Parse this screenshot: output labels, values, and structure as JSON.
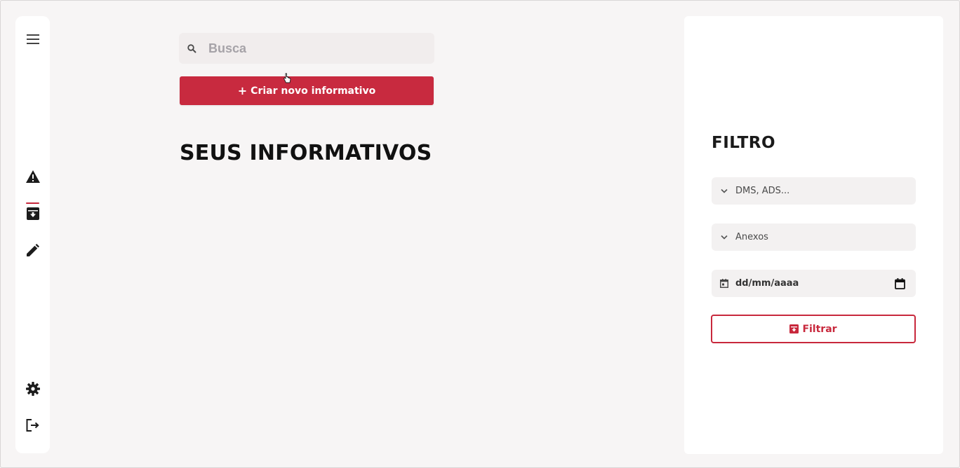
{
  "sidebar": {
    "items": [
      {
        "name": "menu",
        "icon": "menu-icon"
      },
      {
        "name": "warning",
        "icon": "warning-icon",
        "active": true
      },
      {
        "name": "archive",
        "icon": "archive-icon"
      },
      {
        "name": "edit",
        "icon": "pencil-icon"
      },
      {
        "name": "settings",
        "icon": "gear-icon"
      },
      {
        "name": "logout",
        "icon": "logout-icon"
      }
    ]
  },
  "main": {
    "search": {
      "placeholder": "Busca",
      "value": ""
    },
    "create_button": {
      "label": "Criar novo informativo",
      "icon": "plus-icon"
    },
    "title": "SEUS INFORMATIVOS"
  },
  "filter": {
    "title": "FILTRO",
    "categories_select": {
      "label": "DMS, ADS...",
      "icon": "chevron-down-icon"
    },
    "attachments_select": {
      "label": "Anexos",
      "icon": "chevron-down-icon"
    },
    "date_input": {
      "placeholder": "dd/mm/aaaa",
      "icon": "calendar-icon"
    },
    "filter_button": {
      "label": "Filtrar",
      "icon": "filter-box-icon"
    }
  },
  "colors": {
    "accent": "#c82a3f",
    "background": "#f7f5f5",
    "panel": "#ffffff",
    "field": "#f3f1f1"
  }
}
